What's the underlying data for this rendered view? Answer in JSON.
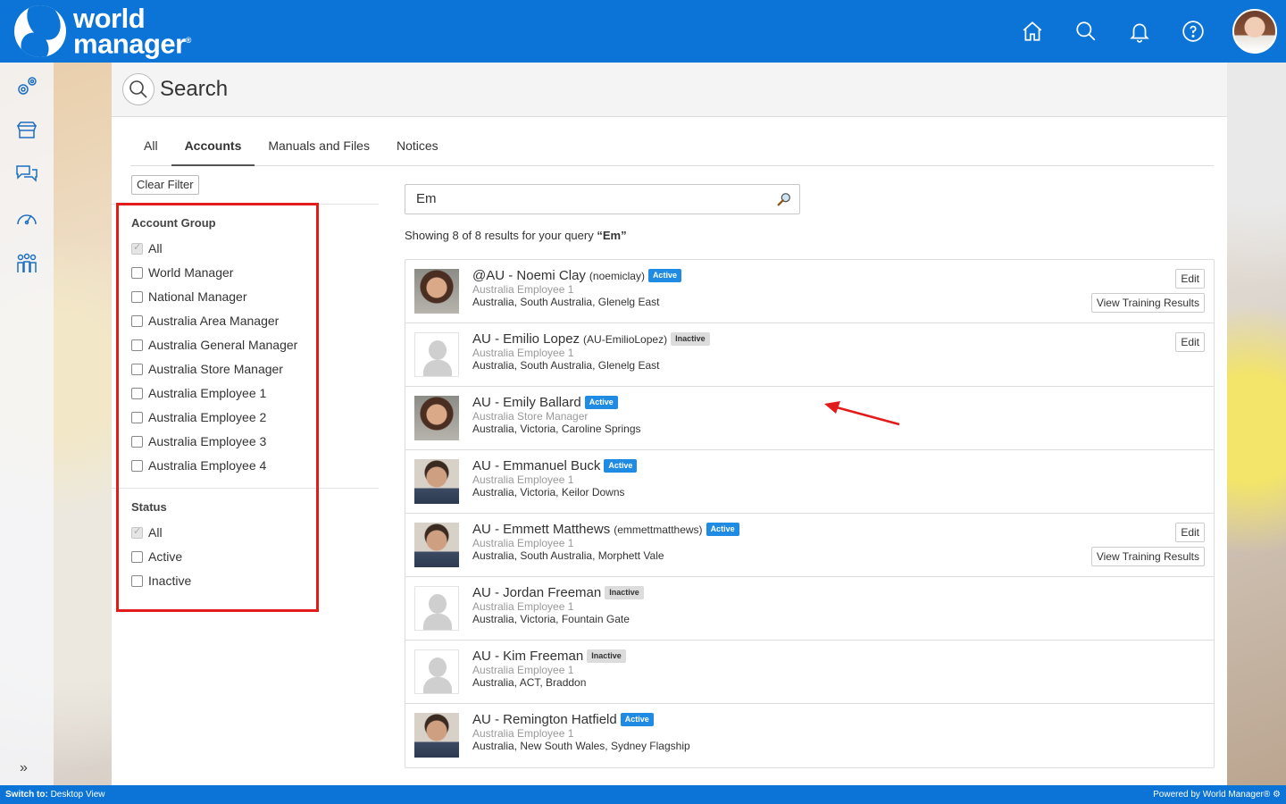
{
  "brand": {
    "line1": "world",
    "line2": "manager"
  },
  "header": {
    "icons": [
      "home-icon",
      "search-icon",
      "bell-icon",
      "help-icon"
    ]
  },
  "sidebar": {
    "icons": [
      "settings-gears-icon",
      "store-icon",
      "chat-icon",
      "dashboard-gauge-icon",
      "people-icon"
    ],
    "expand_glyph": "»"
  },
  "page": {
    "title": "Search"
  },
  "tabs": [
    {
      "label": "All"
    },
    {
      "label": "Accounts"
    },
    {
      "label": "Manuals and Files"
    },
    {
      "label": "Notices"
    }
  ],
  "active_tab": "Accounts",
  "filters": {
    "clear_label": "Clear Filter",
    "account_group": {
      "title": "Account Group",
      "options": [
        {
          "label": "All",
          "checked": true
        },
        {
          "label": "World Manager",
          "checked": false
        },
        {
          "label": "National Manager",
          "checked": false
        },
        {
          "label": "Australia Area Manager",
          "checked": false
        },
        {
          "label": "Australia General Manager",
          "checked": false
        },
        {
          "label": "Australia Store Manager",
          "checked": false
        },
        {
          "label": "Australia Employee 1",
          "checked": false
        },
        {
          "label": "Australia Employee 2",
          "checked": false
        },
        {
          "label": "Australia Employee 3",
          "checked": false
        },
        {
          "label": "Australia Employee 4",
          "checked": false
        }
      ]
    },
    "status": {
      "title": "Status",
      "options": [
        {
          "label": "All",
          "checked": true
        },
        {
          "label": "Active",
          "checked": false
        },
        {
          "label": "Inactive",
          "checked": false
        }
      ]
    }
  },
  "search": {
    "query": "Em",
    "summary_prefix": "Showing 8 of 8 results for your query ",
    "summary_query": "“Em”"
  },
  "results": [
    {
      "name": "@AU - Noemi Clay",
      "username": "(noemiclay)",
      "status": "Active",
      "role": "Australia Employee 1",
      "location": "Australia, South Australia, Glenelg East",
      "photo": "woman-photo",
      "actions": [
        "Edit",
        "View Training Results"
      ]
    },
    {
      "name": "AU - Emilio Lopez",
      "username": "(AU-EmilioLopez)",
      "status": "Inactive",
      "role": "Australia Employee 1",
      "location": "Australia, South Australia, Glenelg East",
      "photo": "placeholder",
      "actions": [
        "Edit"
      ]
    },
    {
      "name": "AU - Emily Ballard",
      "username": "",
      "status": "Active",
      "role": "Australia Store Manager",
      "location": "Australia, Victoria, Caroline Springs",
      "photo": "woman-photo",
      "actions": []
    },
    {
      "name": "AU - Emmanuel Buck",
      "username": "",
      "status": "Active",
      "role": "Australia Employee 1",
      "location": "Australia, Victoria, Keilor Downs",
      "photo": "man-photo",
      "actions": []
    },
    {
      "name": "AU - Emmett Matthews",
      "username": "(emmettmatthews)",
      "status": "Active",
      "role": "Australia Employee 1",
      "location": "Australia, South Australia, Morphett Vale",
      "photo": "man-photo",
      "actions": [
        "Edit",
        "View Training Results"
      ]
    },
    {
      "name": "AU - Jordan Freeman",
      "username": "",
      "status": "Inactive",
      "role": "Australia Employee 1",
      "location": "Australia, Victoria, Fountain Gate",
      "photo": "placeholder",
      "actions": []
    },
    {
      "name": "AU - Kim Freeman",
      "username": "",
      "status": "Inactive",
      "role": "Australia Employee 1",
      "location": "Australia, ACT, Braddon",
      "photo": "placeholder",
      "actions": []
    },
    {
      "name": "AU - Remington Hatfield",
      "username": "",
      "status": "Active",
      "role": "Australia Employee 1",
      "location": "Australia, New South Wales, Sydney Flagship",
      "photo": "man-photo",
      "actions": []
    }
  ],
  "footer": {
    "switch_label": "Switch to:",
    "switch_target": "Desktop View",
    "powered": "Powered by World Manager®"
  },
  "colors": {
    "brand": "#0b74d6",
    "active_badge": "#1f8be3",
    "highlight": "#e21b1b"
  }
}
